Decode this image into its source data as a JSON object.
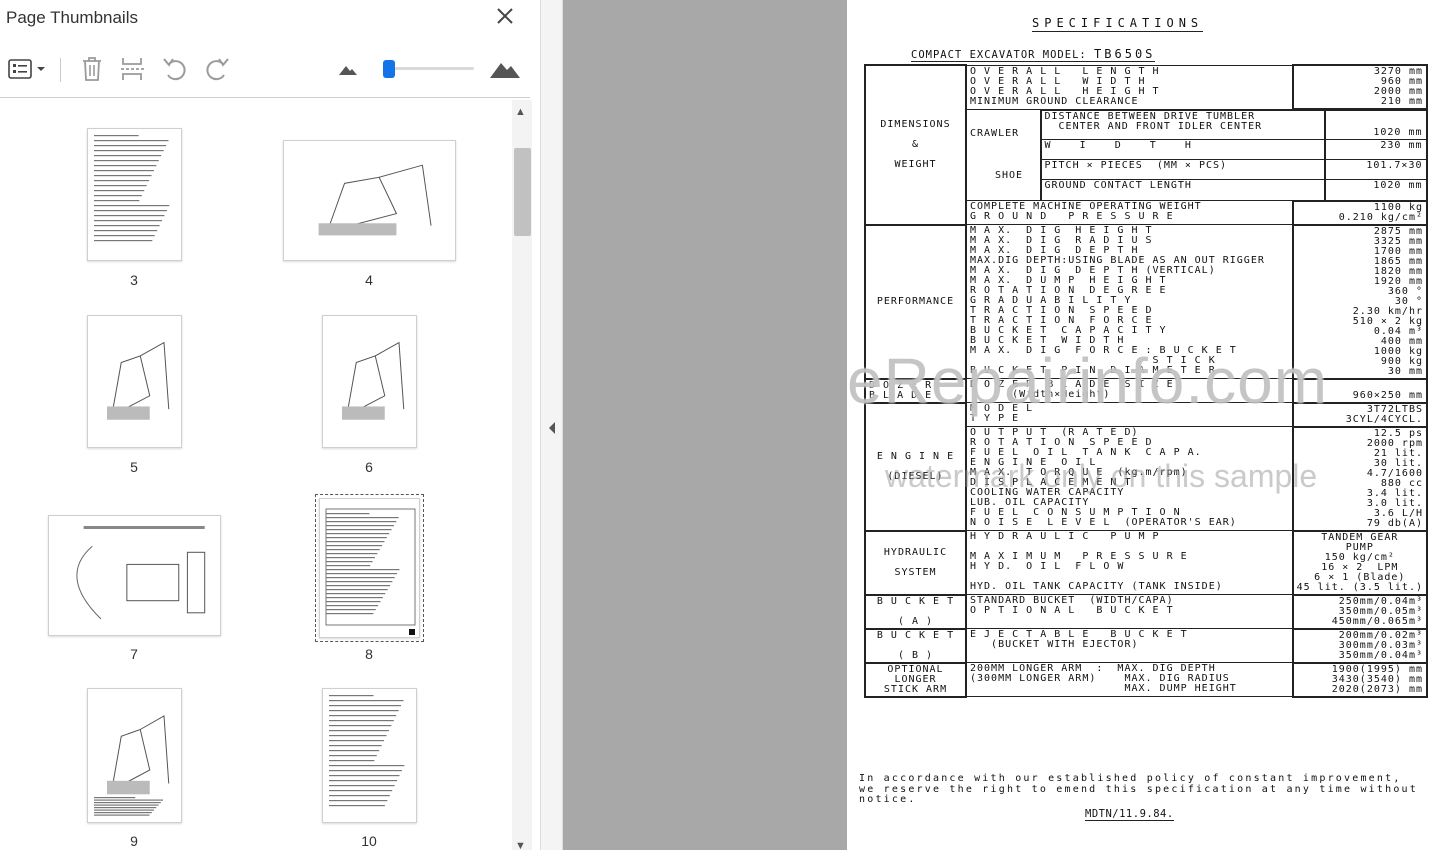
{
  "panel": {
    "title": "Page Thumbnails",
    "close_icon": "close-icon",
    "toolbar": [
      {
        "name": "thumbnail-options-button",
        "icon": "list-options-icon"
      },
      {
        "name": "delete-pages-button",
        "icon": "trash-icon"
      },
      {
        "name": "insert-pages-button",
        "icon": "insert-pages-icon"
      },
      {
        "name": "rotate-left-button",
        "icon": "rotate-ccw-icon"
      },
      {
        "name": "rotate-right-button",
        "icon": "rotate-cw-icon"
      }
    ],
    "zoom_slider_fraction": 0.03
  },
  "thumbnails": [
    {
      "label": "3",
      "kind": "text"
    },
    {
      "label": "4",
      "kind": "drawing"
    },
    {
      "label": "5",
      "kind": "drawing"
    },
    {
      "label": "6",
      "kind": "drawing"
    },
    {
      "label": "7",
      "kind": "wide"
    },
    {
      "label": "8",
      "kind": "table",
      "selected": true
    },
    {
      "label": "9",
      "kind": "diagram"
    },
    {
      "label": "10",
      "kind": "text"
    }
  ],
  "document": {
    "title": "SPECIFICATIONS",
    "subtitle_prefix": "COMPACT EXCAVATOR MODEL:",
    "model": "TB650S",
    "watermark": "eRepairinfo.com",
    "watermark_sub": "watermark only on this sample",
    "sections": {
      "dimensions": {
        "category": "DIMENSIONS\n\n&\n\nWEIGHT",
        "overall_items": "O V E R A L L   L E N G T H\nO V E R A L L   W I D T H\nO V E R A L L   H E I G H T\nMINIMUM GROUND CLEARANCE",
        "overall_values": "3270 mm\n960 mm\n2000 mm\n210 mm",
        "crawler_label": "CRAWLER",
        "shoe_label": "SHOE",
        "crawler_rows": [
          {
            "item": "DISTANCE BETWEEN DRIVE TUMBLER\n  CENTER AND FRONT IDLER CENTER",
            "value": "1020 mm"
          },
          {
            "item": "W    I    D    T    H",
            "value": "230 mm"
          },
          {
            "item": "PITCH × PIECES  (MM × PCS)",
            "value": "101.7×30"
          },
          {
            "item": "GROUND CONTACT LENGTH",
            "value": "1020 mm"
          }
        ],
        "weight_items": "COMPLETE MACHINE OPERATING WEIGHT\nG R O U N D   P R E S S U R E",
        "weight_values": "1100 kg\n0.210 kg/cm²"
      },
      "performance": {
        "category": "PERFORMANCE",
        "items": "M A X.  D I G  H E I G H T\nM A X.  D I G  R A D I U S\nM A X.  D I G  D E P T H\nMAX.DIG DEPTH:USING BLADE AS AN OUT RIGGER\nM A X.  D I G  D E P T H (VERTICAL)\nM A X.  D U M P  H E I G H T\nR O T A T I O N  D E G R E E\nG R A D U A B I L I T Y\nT R A C T I O N  S P E E D\nT R A C T I O N  F O R C E\nB U C K E T  C A P A C I T Y\nB U C K E T  W I D T H\nM A X.  D I G  F O R C E : B U C K E T\n                          S T I C K\nB U C K E T  P I N  D I A M E T E R",
        "values": "2875 mm\n3325 mm\n1700 mm\n1865 mm\n1820 mm\n1920 mm\n360 °\n30 °\n2.30 km/hr\n510 × 2 kg\n0.04 m³\n400 mm\n1000 kg\n900 kg\n30 mm"
      },
      "dozer": {
        "category": "D O Z E R\nB L A D E",
        "items": "D O Z E R  B L A D E  S I Z E\n      (Width×Height)",
        "values": "960×250 mm"
      },
      "engine": {
        "category": "E N G I N E\n\n(DIESEL)",
        "model_items": "M O D E L\nT Y P E",
        "model_values": "3T72LTBS\n3CYL/4CYCL.",
        "items": "O U T P U T  (R A T E D)\nR O T A T I O N  S P E E D\nF U E L  O I L  T A N K  C A P A.\nE N G I N E  O I L\nM A X.  T O R Q U E  (kg.m/rpm)\nD I S P L A C E M E N T\nCOOLING WATER CAPACITY\nLUB. OIL CAPACITY\nF U E L  C O N S U M P T I O N\nN O I S E  L E V E L  (OPERATOR'S EAR)",
        "values": "12.5 ps\n2000 rpm\n21 lit.\n30 lit.\n4.7/1600\n880 cc\n3.4 lit.\n3.0 lit.\n3.6 L/H\n79 db(A)"
      },
      "hydraulic": {
        "category": "HYDRAULIC\n\nSYSTEM",
        "items": "H Y D R A U L I C   P U M P\n\nM A X I M U M   P R E S S U R E\nH Y D.  O I L  F L O W\n\nHYD. OIL TANK CAPACITY (TANK INSIDE)",
        "values": "TANDEM GEAR\nPUMP\n150 kg/cm²\n16 × 2  LPM\n6 × 1 (Blade)\n45 lit. (3.5 lit.)"
      },
      "bucket_a": {
        "category": "B U C K E T\n\n( A )",
        "items": "STANDARD BUCKET  (WIDTH/CAPA)\nO P T I O N A L   B U C K E T",
        "values": "250mm/0.04m³\n350mm/0.05m³\n450mm/0.065m³"
      },
      "bucket_b": {
        "category": "B U C K E T\n\n( B )",
        "items": "E J E C T A B L E   B U C K E T\n   (BUCKET WITH EJECTOR)",
        "values": "200mm/0.02m³\n300mm/0.03m³\n350mm/0.04m³"
      },
      "optional_arm": {
        "category": "OPTIONAL\nLONGER\nSTICK ARM",
        "items": "200MM LONGER ARM  :  MAX. DIG DEPTH\n(300MM LONGER ARM)    MAX. DIG RADIUS\n                      MAX. DUMP HEIGHT",
        "values": "1900(1995) mm\n3430(3540) mm\n2020(2073) mm"
      }
    },
    "footnote": "In accordance with our established policy of constant improvement,\nwe reserve the right to emend this specification at any time without\nnotice.",
    "doc_number": "MDTN/11.9.84."
  }
}
